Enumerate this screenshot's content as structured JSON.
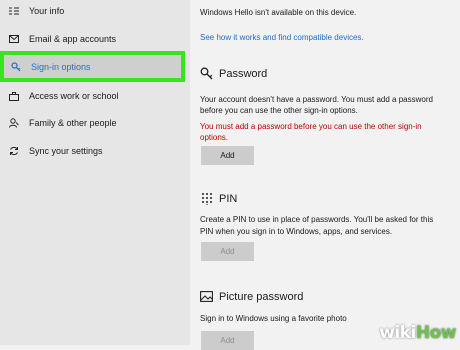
{
  "sidebar": {
    "items": [
      {
        "label": "Your info",
        "icon": "person-card-icon"
      },
      {
        "label": "Email & app accounts",
        "icon": "mail-icon"
      },
      {
        "label": "Sign-in options",
        "icon": "key-icon",
        "selected": true
      },
      {
        "label": "Access work or school",
        "icon": "briefcase-icon"
      },
      {
        "label": "Family & other people",
        "icon": "people-icon"
      },
      {
        "label": "Sync your settings",
        "icon": "sync-icon"
      }
    ]
  },
  "hello": {
    "message": "Windows Hello isn't available on this device.",
    "link": "See how it works and find compatible devices."
  },
  "password": {
    "title": "Password",
    "desc_line1": "Your account doesn't have a password. You must add a password",
    "desc_line2": "before you can use the other sign-in options.",
    "warning_line1": "You must add a password before you can use the other sign-in",
    "warning_line2": "options.",
    "button": "Add"
  },
  "pin": {
    "title": "PIN",
    "desc_line1": "Create a PIN to use in place of passwords. You'll be asked for this",
    "desc_line2": "PIN when you sign in to Windows, apps, and services.",
    "button": "Add"
  },
  "picture": {
    "title": "Picture password",
    "desc": "Sign in to Windows using a favorite photo",
    "button": "Add"
  },
  "watermark": {
    "part1": "wiki",
    "part2": "How"
  },
  "colors": {
    "accent": "#1f6ac9",
    "highlight": "#37e51c",
    "warning": "#c00000"
  }
}
